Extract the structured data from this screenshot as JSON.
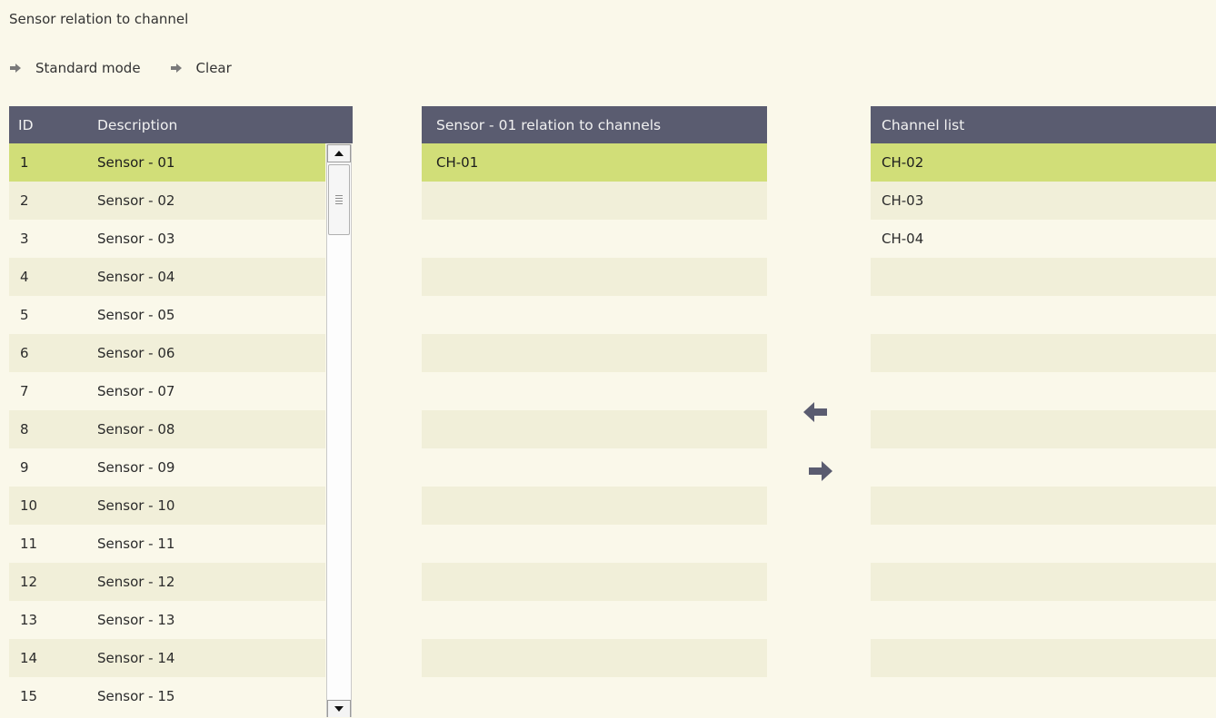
{
  "page": {
    "title": "Sensor relation to channel"
  },
  "toolbar": {
    "standard_mode": "Standard mode",
    "clear": "Clear"
  },
  "sensor_table": {
    "headers": {
      "id": "ID",
      "description": "Description"
    },
    "selected_index": 0,
    "rows": [
      {
        "id": "1",
        "description": "Sensor - 01"
      },
      {
        "id": "2",
        "description": "Sensor - 02"
      },
      {
        "id": "3",
        "description": "Sensor - 03"
      },
      {
        "id": "4",
        "description": "Sensor - 04"
      },
      {
        "id": "5",
        "description": "Sensor - 05"
      },
      {
        "id": "6",
        "description": "Sensor - 06"
      },
      {
        "id": "7",
        "description": "Sensor - 07"
      },
      {
        "id": "8",
        "description": "Sensor - 08"
      },
      {
        "id": "9",
        "description": "Sensor - 09"
      },
      {
        "id": "10",
        "description": "Sensor - 10"
      },
      {
        "id": "11",
        "description": "Sensor - 11"
      },
      {
        "id": "12",
        "description": "Sensor - 12"
      },
      {
        "id": "13",
        "description": "Sensor - 13"
      },
      {
        "id": "14",
        "description": "Sensor - 14"
      },
      {
        "id": "15",
        "description": "Sensor - 15"
      }
    ]
  },
  "relation_list": {
    "header": "Sensor - 01 relation to channels",
    "selected_index": 0,
    "items": [
      "CH-01",
      "",
      "",
      "",
      "",
      "",
      "",
      "",
      "",
      "",
      "",
      "",
      "",
      "",
      ""
    ]
  },
  "channel_list": {
    "header": "Channel list",
    "selected_index": 0,
    "items": [
      "CH-02",
      "CH-03",
      "CH-04",
      "",
      "",
      "",
      "",
      "",
      "",
      "",
      "",
      "",
      "",
      "",
      ""
    ]
  },
  "icons": {
    "toolbar_arrow": "arrow-right-icon",
    "move_left": "arrow-left-icon",
    "move_right": "arrow-right-icon",
    "scroll_up": "triangle-up-icon",
    "scroll_down": "triangle-down-icon"
  },
  "colors": {
    "header_bg": "#5a5c70",
    "selected_row": "#d1de78",
    "row_odd": "#faf8ea",
    "row_even": "#f1efd9",
    "arrow": "#5a5c70"
  }
}
